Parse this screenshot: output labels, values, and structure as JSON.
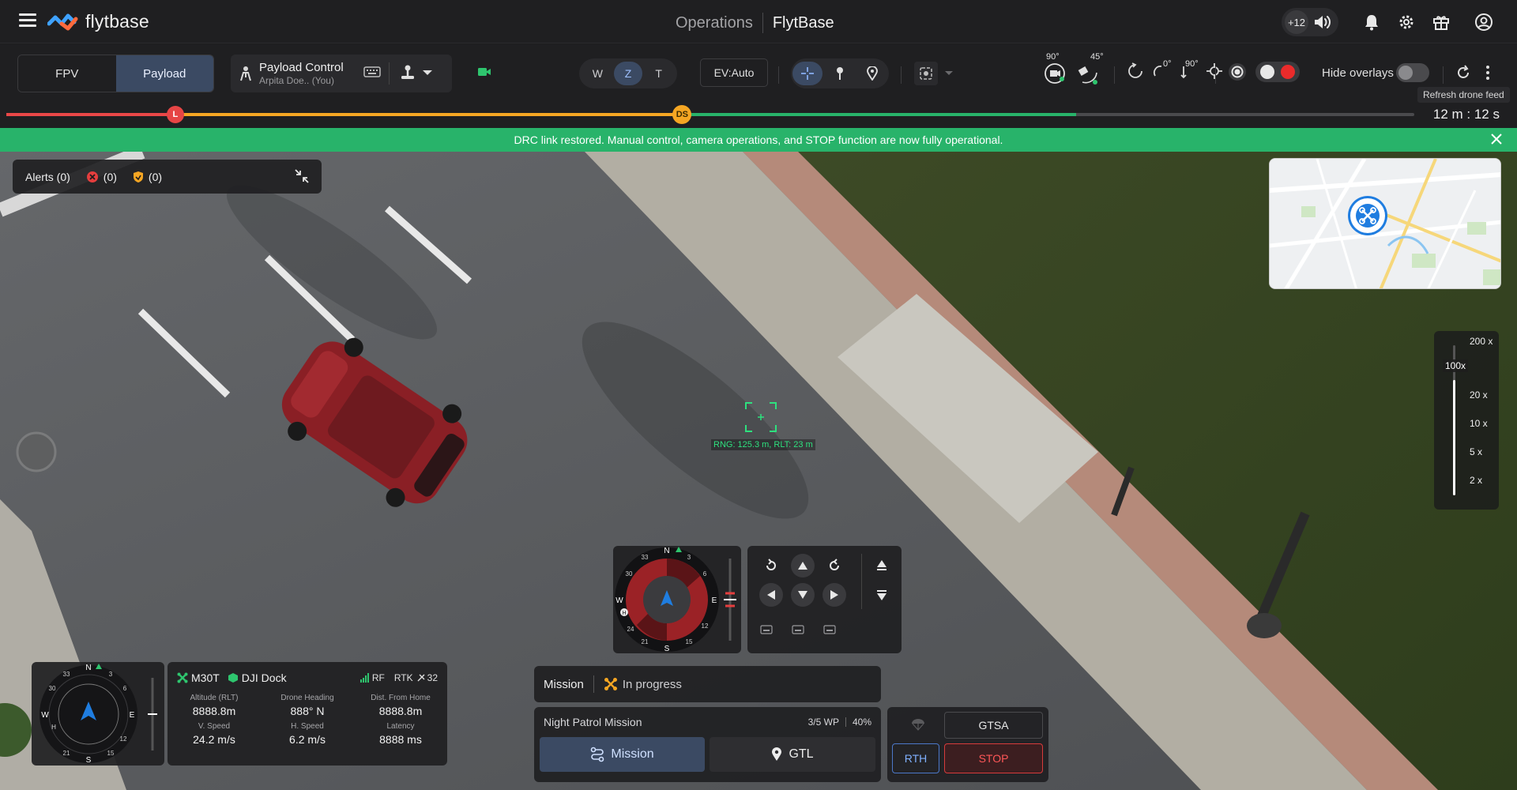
{
  "header": {
    "brand": "flytbase",
    "title_section": "Operations",
    "title_org": "FlytBase",
    "participants_count": "+12"
  },
  "toolbar": {
    "view_fpv": "FPV",
    "view_payload": "Payload",
    "payload_title": "Payload Control",
    "payload_user": "Arpita Doe.. (You)",
    "lens_w": "W",
    "lens_z": "Z",
    "lens_t": "T",
    "ev_label": "EV:Auto",
    "gimbal_up": "90°",
    "gimbal_tilt": "45°",
    "yaw_zero": "0°",
    "yaw_ninety": "90°",
    "hide_overlays": "Hide overlays",
    "refresh_tooltip": "Refresh drone feed"
  },
  "timeline": {
    "marker_l": "L",
    "marker_ds": "DS",
    "time": "12 m : 12 s",
    "progress_red": 0.12,
    "progress_ds": 0.48,
    "progress_green": 0.76
  },
  "banner": {
    "message": "DRC link restored. Manual control, camera operations, and STOP function are now fully operational."
  },
  "alerts": {
    "label": "Alerts (0)",
    "critical": "(0)",
    "warning": "(0)"
  },
  "zoom": {
    "current": "100x",
    "levels": [
      "200 x",
      "20 x",
      "10 x",
      "5 x",
      "2 x"
    ]
  },
  "target": {
    "range": "RNG: 125.3 m, RLT: 23 m"
  },
  "compass": {
    "n": "N",
    "e": "E",
    "s": "S",
    "w": "W",
    "h": "H",
    "t3": "3",
    "t6": "6",
    "t12": "12",
    "t15": "15",
    "t21": "21",
    "t24": "24",
    "t30": "30",
    "t33": "33"
  },
  "telemetry": {
    "drone": "M30T",
    "dock": "DJI Dock",
    "rf": "RF",
    "rtk": "RTK",
    "sats": "32",
    "cells": [
      {
        "k": "Altitude (RLT)",
        "v": "8888.8m"
      },
      {
        "k": "Drone Heading",
        "v": "888° N"
      },
      {
        "k": "Dist. From Home",
        "v": "8888.8m"
      },
      {
        "k": "V. Speed",
        "v": "24.2 m/s"
      },
      {
        "k": "H. Speed",
        "v": "6.2 m/s"
      },
      {
        "k": "Latency",
        "v": "8888 ms"
      }
    ]
  },
  "mission": {
    "label": "Mission",
    "status": "In progress",
    "name": "Night Patrol Mission",
    "waypoints": "3/5 WP",
    "percent": "40%",
    "btn_mission": "Mission",
    "btn_gtl": "GTL"
  },
  "safety": {
    "gtsa": "GTSA",
    "rth": "RTH",
    "stop": "STOP"
  },
  "colors": {
    "accent": "#3b4a63",
    "success": "#28b36a",
    "danger": "#ff5757",
    "timeline_orange": "#f5a623"
  }
}
